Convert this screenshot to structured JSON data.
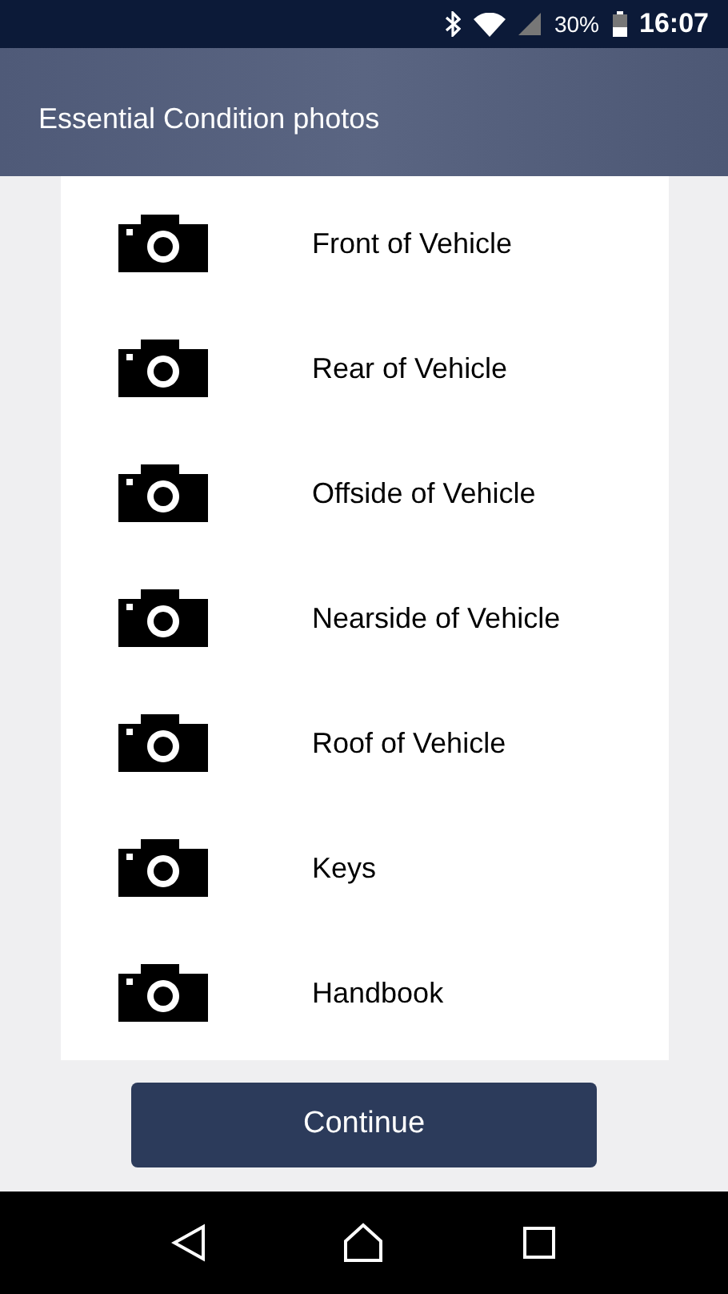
{
  "status_bar": {
    "battery": "30%",
    "time": "16:07"
  },
  "header": {
    "title": "Essential Condition photos"
  },
  "photos": [
    {
      "label": "Front of Vehicle"
    },
    {
      "label": "Rear of Vehicle"
    },
    {
      "label": "Offside of Vehicle"
    },
    {
      "label": "Nearside of Vehicle"
    },
    {
      "label": "Roof of Vehicle"
    },
    {
      "label": "Keys"
    },
    {
      "label": "Handbook"
    }
  ],
  "buttons": [
    "Continue"
  ]
}
